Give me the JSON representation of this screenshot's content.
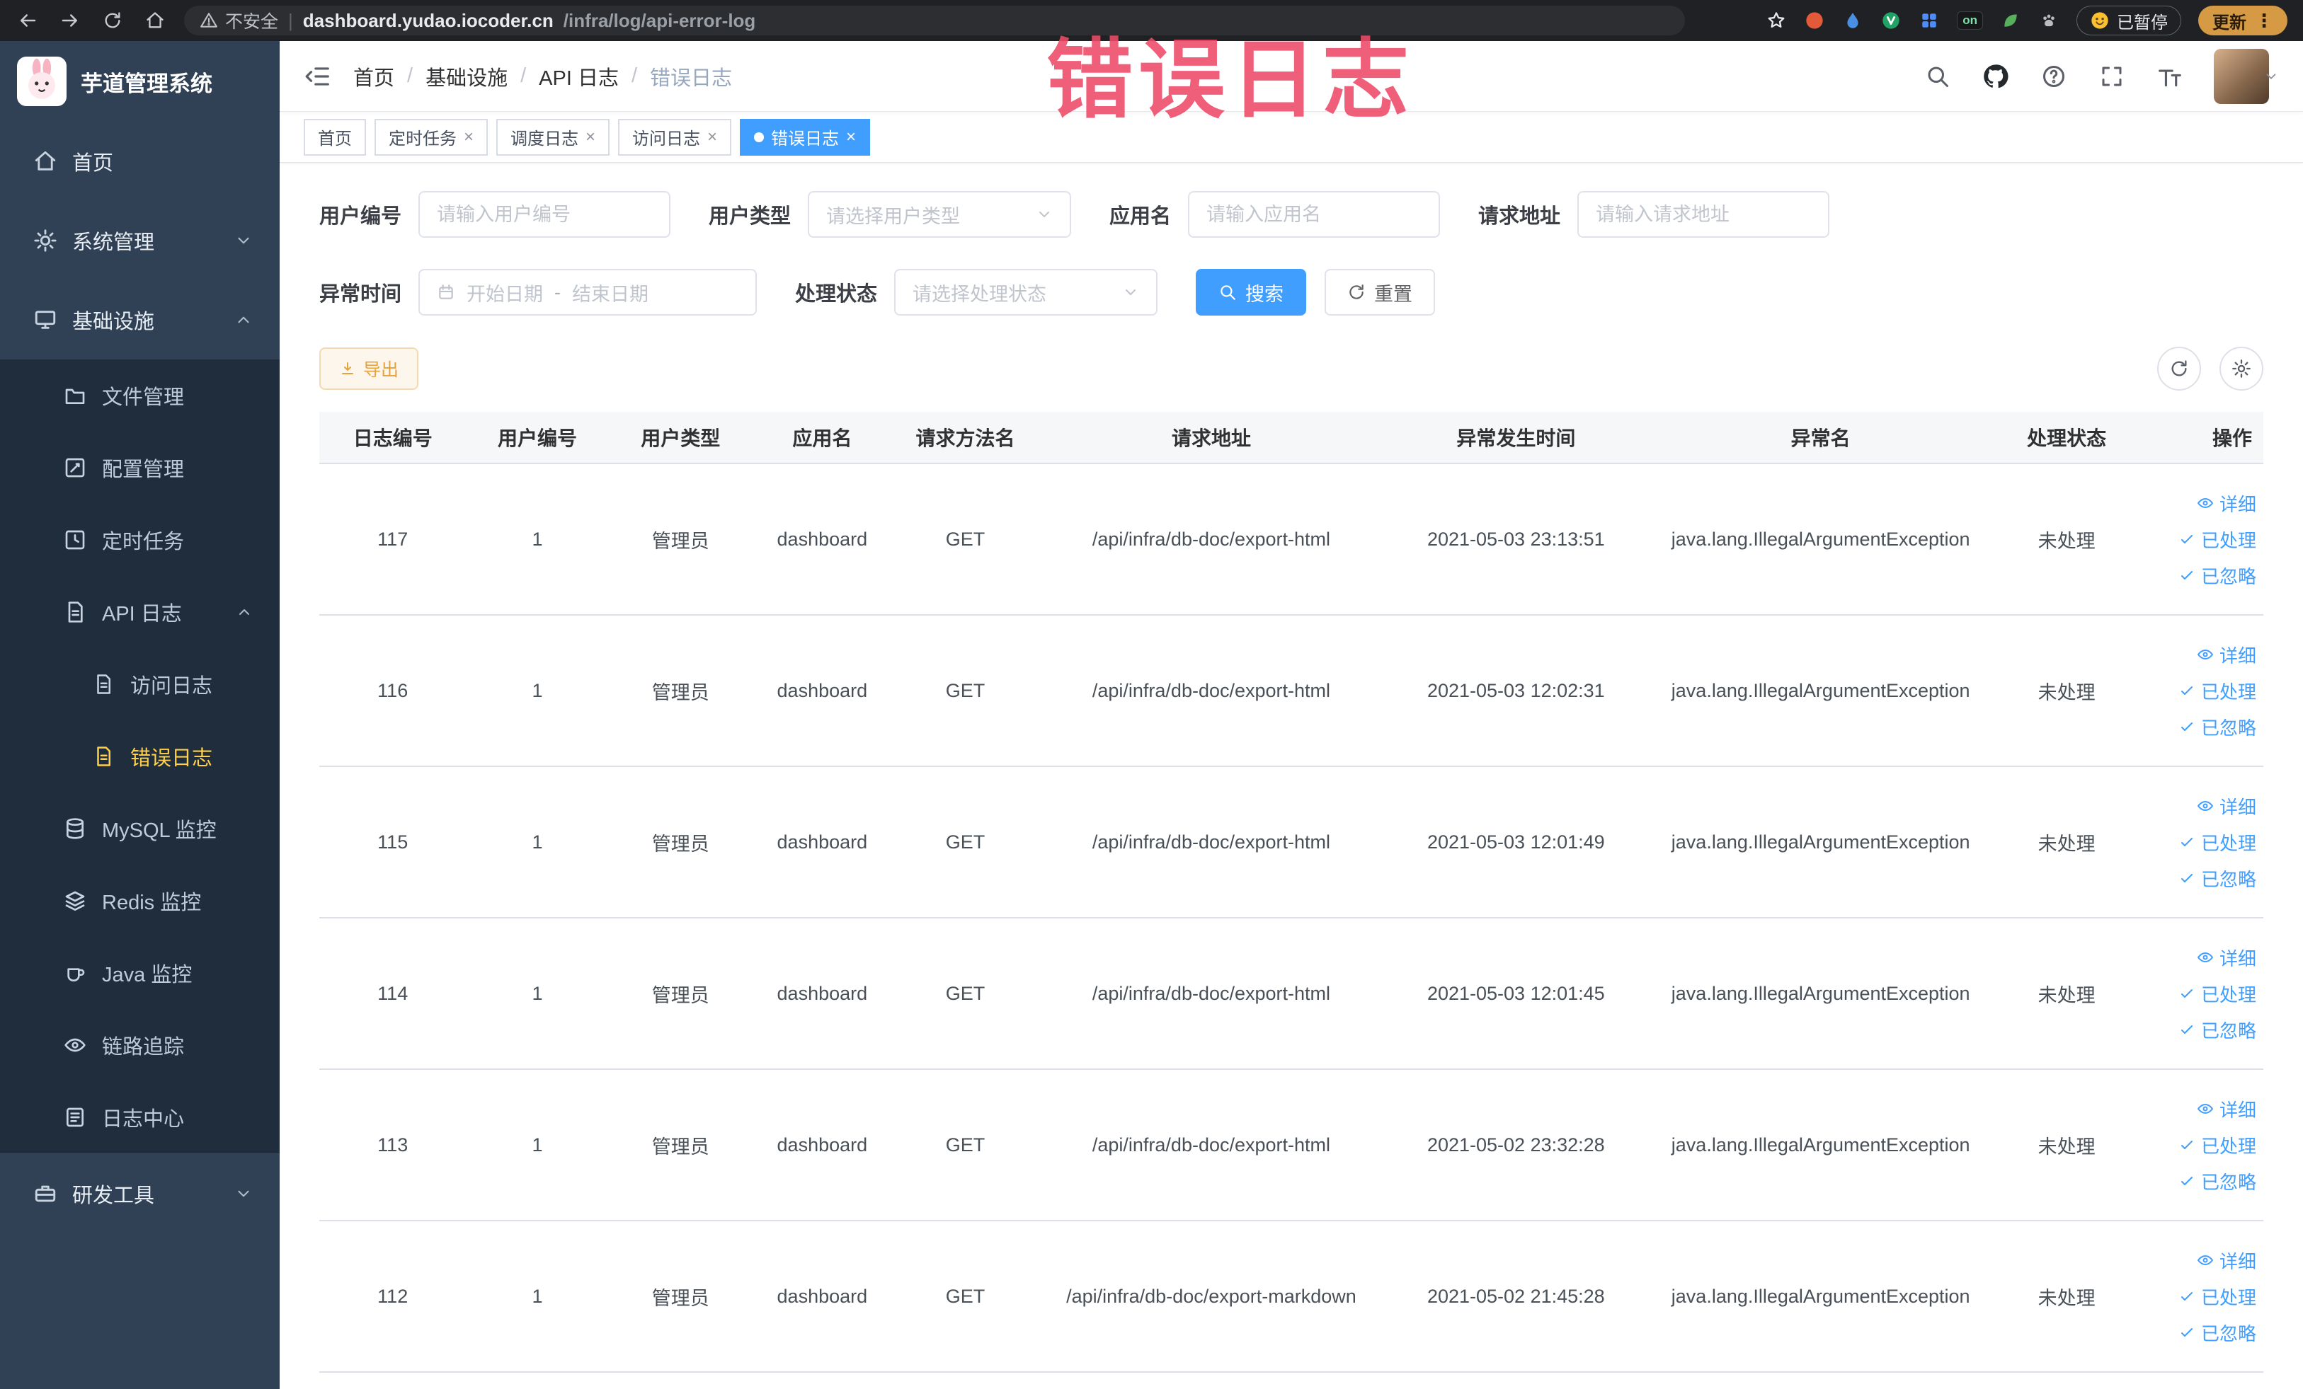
{
  "browser": {
    "security_label": "不安全",
    "url_host": "dashboard.yudao.iocoder.cn",
    "url_path": "/infra/log/api-error-log",
    "ext_on_badge": "on",
    "paused_button": "已暂停",
    "update_button": "更新"
  },
  "annotation": "错误日志",
  "sidebar": {
    "logo_title": "芋道管理系统",
    "items": {
      "home": "首页",
      "system": "系统管理",
      "infra": "基础设施",
      "file": "文件管理",
      "config": "配置管理",
      "job": "定时任务",
      "api_log": "API 日志",
      "access_log": "访问日志",
      "error_log": "错误日志",
      "mysql": "MySQL 监控",
      "redis": "Redis 监控",
      "java": "Java 监控",
      "trace": "链路追踪",
      "log_center": "日志中心",
      "dev_tools": "研发工具"
    }
  },
  "header": {
    "breadcrumb": [
      "首页",
      "基础设施",
      "API 日志",
      "错误日志"
    ],
    "breadcrumb_separator": "/"
  },
  "tabs": [
    {
      "label": "首页",
      "closable": false,
      "active": false
    },
    {
      "label": "定时任务",
      "closable": true,
      "active": false
    },
    {
      "label": "调度日志",
      "closable": true,
      "active": false
    },
    {
      "label": "访问日志",
      "closable": true,
      "active": false
    },
    {
      "label": "错误日志",
      "closable": true,
      "active": true
    }
  ],
  "filters": {
    "user_id": {
      "label": "用户编号",
      "placeholder": "请输入用户编号",
      "value": ""
    },
    "user_type": {
      "label": "用户类型",
      "placeholder": "请选择用户类型"
    },
    "app_name": {
      "label": "应用名",
      "placeholder": "请输入应用名",
      "value": ""
    },
    "request_url": {
      "label": "请求地址",
      "placeholder": "请输入请求地址",
      "value": ""
    },
    "exception_time": {
      "label": "异常时间",
      "start_placeholder": "开始日期",
      "separator": "-",
      "end_placeholder": "结束日期"
    },
    "process_status": {
      "label": "处理状态",
      "placeholder": "请选择处理状态"
    },
    "search_button": "搜索",
    "reset_button": "重置"
  },
  "toolbar": {
    "export_button": "导出"
  },
  "table": {
    "columns": [
      "日志编号",
      "用户编号",
      "用户类型",
      "应用名",
      "请求方法名",
      "请求地址",
      "异常发生时间",
      "异常名",
      "处理状态",
      "操作"
    ],
    "action_labels": {
      "detail": "详细",
      "processed": "已处理",
      "ignored": "已忽略"
    },
    "rows": [
      {
        "id": "117",
        "user_id": "1",
        "user_type": "管理员",
        "app": "dashboard",
        "method": "GET",
        "url": "/api/infra/db-doc/export-html",
        "time": "2021-05-03 23:13:51",
        "exception": "java.lang.IllegalArgumentException",
        "status": "未处理"
      },
      {
        "id": "116",
        "user_id": "1",
        "user_type": "管理员",
        "app": "dashboard",
        "method": "GET",
        "url": "/api/infra/db-doc/export-html",
        "time": "2021-05-03 12:02:31",
        "exception": "java.lang.IllegalArgumentException",
        "status": "未处理"
      },
      {
        "id": "115",
        "user_id": "1",
        "user_type": "管理员",
        "app": "dashboard",
        "method": "GET",
        "url": "/api/infra/db-doc/export-html",
        "time": "2021-05-03 12:01:49",
        "exception": "java.lang.IllegalArgumentException",
        "status": "未处理"
      },
      {
        "id": "114",
        "user_id": "1",
        "user_type": "管理员",
        "app": "dashboard",
        "method": "GET",
        "url": "/api/infra/db-doc/export-html",
        "time": "2021-05-03 12:01:45",
        "exception": "java.lang.IllegalArgumentException",
        "status": "未处理"
      },
      {
        "id": "113",
        "user_id": "1",
        "user_type": "管理员",
        "app": "dashboard",
        "method": "GET",
        "url": "/api/infra/db-doc/export-html",
        "time": "2021-05-02 23:32:28",
        "exception": "java.lang.IllegalArgumentException",
        "status": "未处理"
      },
      {
        "id": "112",
        "user_id": "1",
        "user_type": "管理员",
        "app": "dashboard",
        "method": "GET",
        "url": "/api/infra/db-doc/export-markdown",
        "time": "2021-05-02 21:45:28",
        "exception": "java.lang.IllegalArgumentException",
        "status": "未处理"
      }
    ]
  },
  "colors": {
    "primary": "#409eff",
    "warning": "#e6a23c",
    "sidebar-bg": "#304156",
    "sidebar-sub-bg": "#1f2d3d",
    "menu-active": "#ffd04b",
    "annotation": "#ee4a67"
  }
}
